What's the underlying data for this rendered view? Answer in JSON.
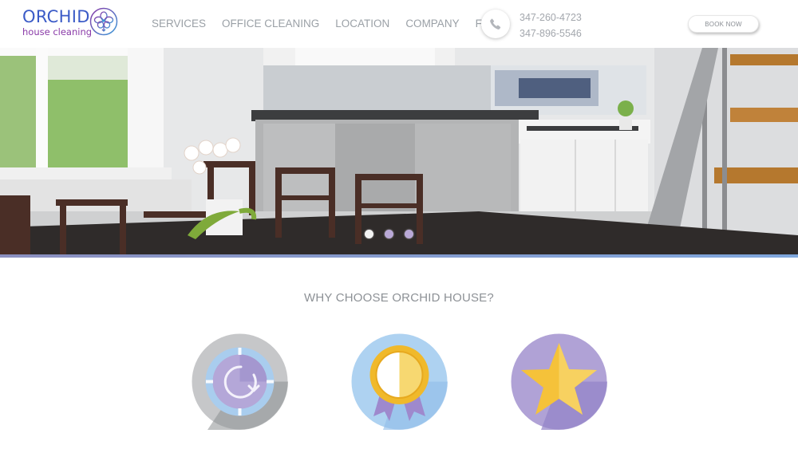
{
  "brand": {
    "title": "ORCHID",
    "subtitle": "house cleaning"
  },
  "nav": {
    "items": [
      "SERVICES",
      "OFFICE CLEANING",
      "LOCATION",
      "COMPANY",
      "FAQ"
    ]
  },
  "contact": {
    "icon": "phone-icon",
    "phones": [
      "347-260-4723",
      "347-896-5546"
    ]
  },
  "header": {
    "book_label": "BOOK NOW"
  },
  "hero": {
    "slides_total": 3,
    "active_slide": 1
  },
  "why": {
    "title": "WHY CHOOSE ORCHID HOUSE?",
    "features": [
      {
        "icon": "clock-icon"
      },
      {
        "icon": "medal-icon"
      },
      {
        "icon": "star-icon"
      }
    ]
  },
  "colors": {
    "brand_blue": "#3b5bc7",
    "brand_purple": "#8a3aa8",
    "nav_text": "#9aa0a6",
    "accent_bar_start": "#8b8fbf",
    "accent_bar_end": "#7fa7dd"
  }
}
